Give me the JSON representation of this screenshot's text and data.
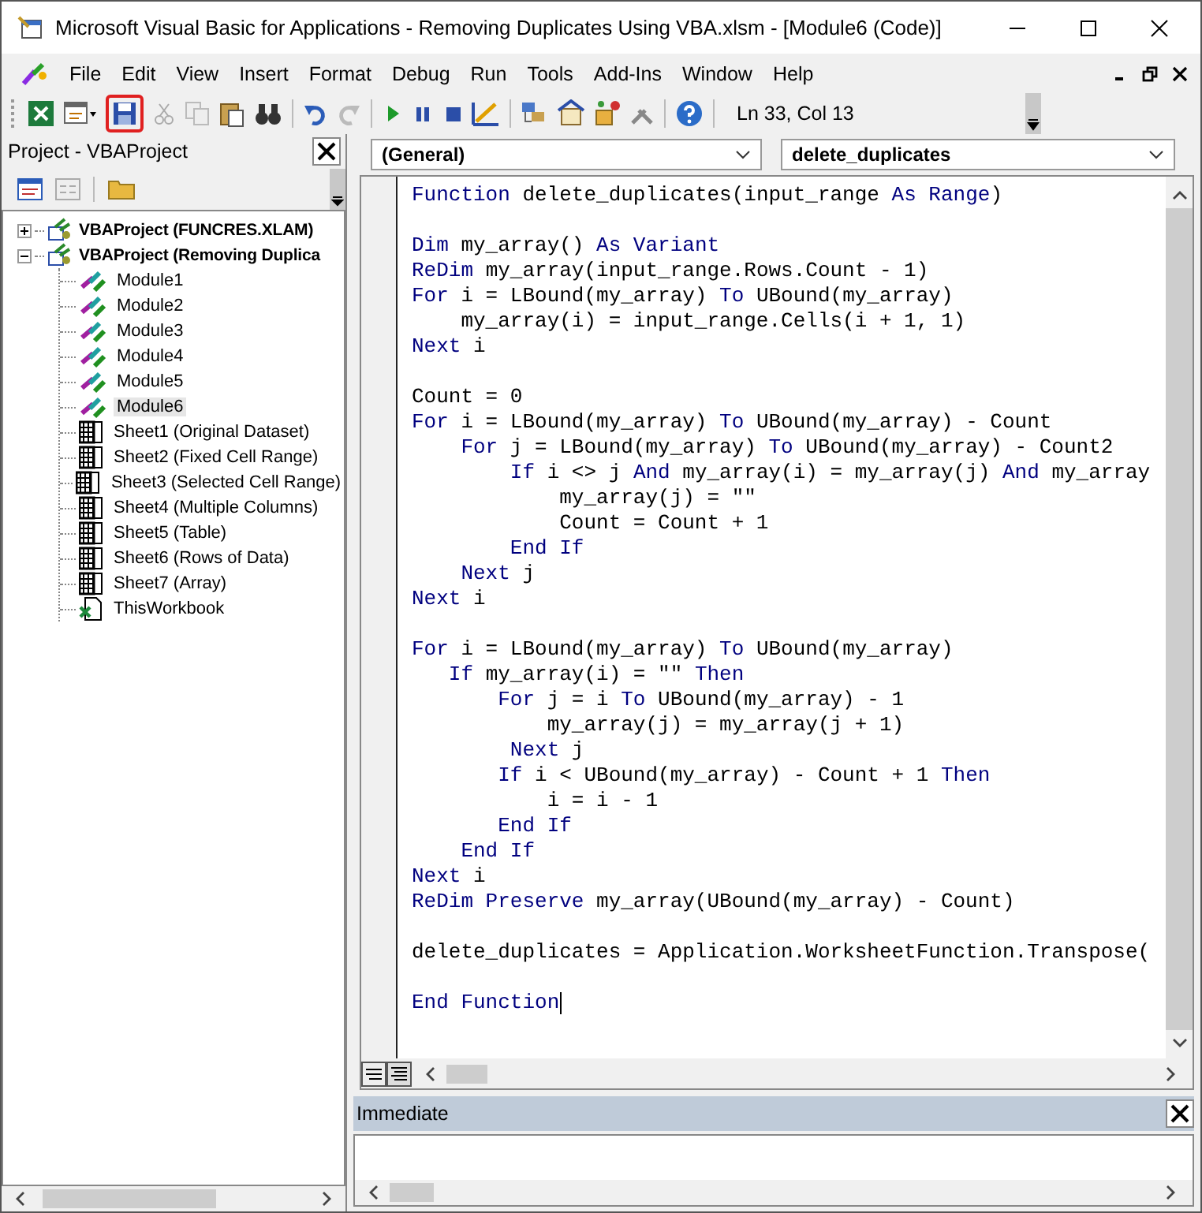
{
  "window": {
    "title": "Microsoft Visual Basic for Applications - Removing Duplicates Using VBA.xlsm - [Module6 (Code)]"
  },
  "menu": [
    "File",
    "Edit",
    "View",
    "Insert",
    "Format",
    "Debug",
    "Run",
    "Tools",
    "Add-Ins",
    "Window",
    "Help"
  ],
  "toolbar": {
    "position": "Ln 33, Col 13"
  },
  "project_pane": {
    "title": "Project - VBAProject",
    "tree": [
      {
        "label": "VBAProject (FUNCRES.XLAM)",
        "expanded": false
      },
      {
        "label": "VBAProject (Removing Duplica",
        "expanded": true,
        "children": [
          {
            "label": "Module1",
            "kind": "module",
            "selected": false
          },
          {
            "label": "Module2",
            "kind": "module",
            "selected": false
          },
          {
            "label": "Module3",
            "kind": "module",
            "selected": false
          },
          {
            "label": "Module4",
            "kind": "module",
            "selected": false
          },
          {
            "label": "Module5",
            "kind": "module",
            "selected": false
          },
          {
            "label": "Module6",
            "kind": "module",
            "selected": true
          },
          {
            "label": "Sheet1 (Original Dataset)",
            "kind": "sheet",
            "selected": false
          },
          {
            "label": "Sheet2 (Fixed Cell Range)",
            "kind": "sheet",
            "selected": false
          },
          {
            "label": "Sheet3 (Selected Cell Range)",
            "kind": "sheet",
            "selected": false
          },
          {
            "label": "Sheet4 (Multiple Columns)",
            "kind": "sheet",
            "selected": false
          },
          {
            "label": "Sheet5 (Table)",
            "kind": "sheet",
            "selected": false
          },
          {
            "label": "Sheet6 (Rows of Data)",
            "kind": "sheet",
            "selected": false
          },
          {
            "label": "Sheet7 (Array)",
            "kind": "sheet",
            "selected": false
          },
          {
            "label": "ThisWorkbook",
            "kind": "workbook",
            "selected": false
          }
        ]
      }
    ]
  },
  "code_window": {
    "object_combo": "(General)",
    "procedure_combo": "delete_duplicates",
    "lines": [
      {
        "kind": "code",
        "parts": [
          {
            "t": "Function",
            "kw": true
          },
          {
            "t": " delete_duplicates(input_range ",
            "kw": false
          },
          {
            "t": "As Range",
            "kw": true
          },
          {
            "t": ")",
            "kw": false
          }
        ]
      },
      {
        "kind": "blank"
      },
      {
        "kind": "code",
        "parts": [
          {
            "t": "Dim",
            "kw": true
          },
          {
            "t": " my_array() ",
            "kw": false
          },
          {
            "t": "As Variant",
            "kw": true
          }
        ]
      },
      {
        "kind": "code",
        "parts": [
          {
            "t": "ReDim",
            "kw": true
          },
          {
            "t": " my_array(input_range.Rows.Count - 1)",
            "kw": false
          }
        ]
      },
      {
        "kind": "code",
        "parts": [
          {
            "t": "For",
            "kw": true
          },
          {
            "t": " i = LBound(my_array) ",
            "kw": false
          },
          {
            "t": "To",
            "kw": true
          },
          {
            "t": " UBound(my_array)",
            "kw": false
          }
        ]
      },
      {
        "kind": "code",
        "parts": [
          {
            "t": "    my_array(i) = input_range.Cells(i + 1, 1)",
            "kw": false
          }
        ]
      },
      {
        "kind": "code",
        "parts": [
          {
            "t": "Next",
            "kw": true
          },
          {
            "t": " i",
            "kw": false
          }
        ]
      },
      {
        "kind": "blank"
      },
      {
        "kind": "code",
        "parts": [
          {
            "t": "Count = 0",
            "kw": false
          }
        ]
      },
      {
        "kind": "code",
        "parts": [
          {
            "t": "For",
            "kw": true
          },
          {
            "t": " i = LBound(my_array) ",
            "kw": false
          },
          {
            "t": "To",
            "kw": true
          },
          {
            "t": " UBound(my_array) - Count",
            "kw": false
          }
        ]
      },
      {
        "kind": "code",
        "parts": [
          {
            "t": "    For",
            "kw": true
          },
          {
            "t": " j = LBound(my_array) ",
            "kw": false
          },
          {
            "t": "To",
            "kw": true
          },
          {
            "t": " UBound(my_array) - Count2",
            "kw": false
          }
        ]
      },
      {
        "kind": "code",
        "parts": [
          {
            "t": "        If",
            "kw": true
          },
          {
            "t": " i <> j ",
            "kw": false
          },
          {
            "t": "And",
            "kw": true
          },
          {
            "t": " my_array(i) = my_array(j) ",
            "kw": false
          },
          {
            "t": "And",
            "kw": true
          },
          {
            "t": " my_array",
            "kw": false
          }
        ]
      },
      {
        "kind": "code",
        "parts": [
          {
            "t": "            my_array(j) = \"\"",
            "kw": false
          }
        ]
      },
      {
        "kind": "code",
        "parts": [
          {
            "t": "            Count = Count + 1",
            "kw": false
          }
        ]
      },
      {
        "kind": "code",
        "parts": [
          {
            "t": "        End If",
            "kw": true
          }
        ]
      },
      {
        "kind": "code",
        "parts": [
          {
            "t": "    Next",
            "kw": true
          },
          {
            "t": " j",
            "kw": false
          }
        ]
      },
      {
        "kind": "code",
        "parts": [
          {
            "t": "Next",
            "kw": true
          },
          {
            "t": " i",
            "kw": false
          }
        ]
      },
      {
        "kind": "blank"
      },
      {
        "kind": "code",
        "parts": [
          {
            "t": "For",
            "kw": true
          },
          {
            "t": " i = LBound(my_array) ",
            "kw": false
          },
          {
            "t": "To",
            "kw": true
          },
          {
            "t": " UBound(my_array)",
            "kw": false
          }
        ]
      },
      {
        "kind": "code",
        "parts": [
          {
            "t": "   If",
            "kw": true
          },
          {
            "t": " my_array(i) = \"\" ",
            "kw": false
          },
          {
            "t": "Then",
            "kw": true
          }
        ]
      },
      {
        "kind": "code",
        "parts": [
          {
            "t": "       For",
            "kw": true
          },
          {
            "t": " j = i ",
            "kw": false
          },
          {
            "t": "To",
            "kw": true
          },
          {
            "t": " UBound(my_array) - 1",
            "kw": false
          }
        ]
      },
      {
        "kind": "code",
        "parts": [
          {
            "t": "           my_array(j) = my_array(j + 1)",
            "kw": false
          }
        ]
      },
      {
        "kind": "code",
        "parts": [
          {
            "t": "        Next",
            "kw": true
          },
          {
            "t": " j",
            "kw": false
          }
        ]
      },
      {
        "kind": "code",
        "parts": [
          {
            "t": "       If",
            "kw": true
          },
          {
            "t": " i < UBound(my_array) - Count + 1 ",
            "kw": false
          },
          {
            "t": "Then",
            "kw": true
          }
        ]
      },
      {
        "kind": "code",
        "parts": [
          {
            "t": "           i = i - 1",
            "kw": false
          }
        ]
      },
      {
        "kind": "code",
        "parts": [
          {
            "t": "       End If",
            "kw": true
          }
        ]
      },
      {
        "kind": "code",
        "parts": [
          {
            "t": "    End If",
            "kw": true
          }
        ]
      },
      {
        "kind": "code",
        "parts": [
          {
            "t": "Next",
            "kw": true
          },
          {
            "t": " i",
            "kw": false
          }
        ]
      },
      {
        "kind": "code",
        "parts": [
          {
            "t": "ReDim Preserve",
            "kw": true
          },
          {
            "t": " my_array(UBound(my_array) - Count)",
            "kw": false
          }
        ]
      },
      {
        "kind": "blank"
      },
      {
        "kind": "code",
        "parts": [
          {
            "t": "delete_duplicates = Application.WorksheetFunction.Transpose(",
            "kw": false
          }
        ]
      },
      {
        "kind": "blank"
      },
      {
        "kind": "code",
        "parts": [
          {
            "t": "End Function",
            "kw": true
          }
        ]
      }
    ]
  },
  "immediate": {
    "title": "Immediate"
  }
}
